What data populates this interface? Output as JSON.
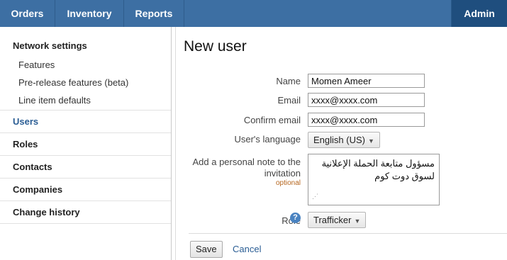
{
  "topnav": {
    "tabs": [
      {
        "label": "Orders"
      },
      {
        "label": "Inventory"
      },
      {
        "label": "Reports"
      }
    ],
    "admin_label": "Admin"
  },
  "sidebar": {
    "section_title": "Network settings",
    "sub_items": [
      {
        "label": "Features"
      },
      {
        "label": "Pre-release features (beta)"
      },
      {
        "label": "Line item defaults"
      }
    ],
    "items": [
      {
        "label": "Users",
        "active": true
      },
      {
        "label": "Roles"
      },
      {
        "label": "Contacts"
      },
      {
        "label": "Companies"
      },
      {
        "label": "Change history"
      }
    ]
  },
  "form": {
    "title": "New user",
    "name_label": "Name",
    "name_value": "Momen Ameer",
    "email_label": "Email",
    "email_value": "xxxx@xxxx.com",
    "confirm_email_label": "Confirm email",
    "confirm_email_value": "xxxx@xxxx.com",
    "language_label": "User's language",
    "language_value": "English (US)",
    "note_label_line1": "Add a personal note to the",
    "note_label_line2": "invitation",
    "note_optional": "optional",
    "note_value": "مسؤول متابعة الحملة الإعلانية لسوق دوت كوم",
    "role_label": "Role",
    "role_help": "?",
    "role_value": "Trafficker",
    "save_label": "Save",
    "cancel_label": "Cancel"
  },
  "colors": {
    "nav_bar": "#3d6fa3",
    "nav_active": "#1f4e7e",
    "link": "#2a5d94",
    "optional_text": "#b5651d",
    "help_icon": "#4a83c1"
  }
}
